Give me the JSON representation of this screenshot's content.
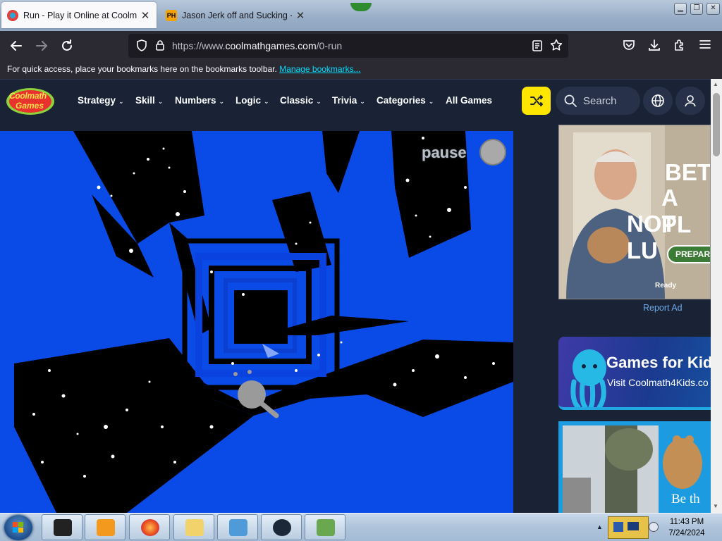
{
  "browser": {
    "tabs": [
      {
        "title": "Run - Play it Online at Coolmath",
        "active": true,
        "favicon": "coolmath-favicon"
      },
      {
        "title": "Jason Jerk off and Sucking - Po",
        "active": false,
        "favicon": "ph-favicon",
        "favicon_text": "PH"
      }
    ],
    "url_prefix": "https://www.",
    "url_host": "coolmathgames.com",
    "url_path": "/0-run",
    "bookmarks_hint": "For quick access, place your bookmarks here on the bookmarks toolbar.",
    "manage_bookmarks": "Manage bookmarks..."
  },
  "site": {
    "logo_line1": "Coolmath",
    "logo_line2": "Games",
    "categories": [
      {
        "label": "Strategy"
      },
      {
        "label": "Skill"
      },
      {
        "label": "Numbers"
      },
      {
        "label": "Logic"
      },
      {
        "label": "Classic"
      },
      {
        "label": "Trivia"
      },
      {
        "label": "Categories"
      },
      {
        "label": "All Games"
      }
    ],
    "search_label": "Search"
  },
  "game": {
    "pause_label": "pause"
  },
  "ads": {
    "ad1_lines": [
      "BET",
      "A PL",
      "NOT LU"
    ],
    "ad1_button": "PREPARE",
    "ad1_ready": "Ready",
    "report_ad": "Report Ad",
    "ad2_title": "Games for Kid",
    "ad2_sub": "Visit Coolmath4Kids.co",
    "ad3_text": "Be th"
  },
  "taskbar": {
    "time": "11:43 PM",
    "date": "7/24/2024"
  },
  "colors": {
    "game_blue": "#0a4be8",
    "header_bg": "#1a2336",
    "accent_yellow": "#ffe600",
    "link_cyan": "#00ddff"
  }
}
